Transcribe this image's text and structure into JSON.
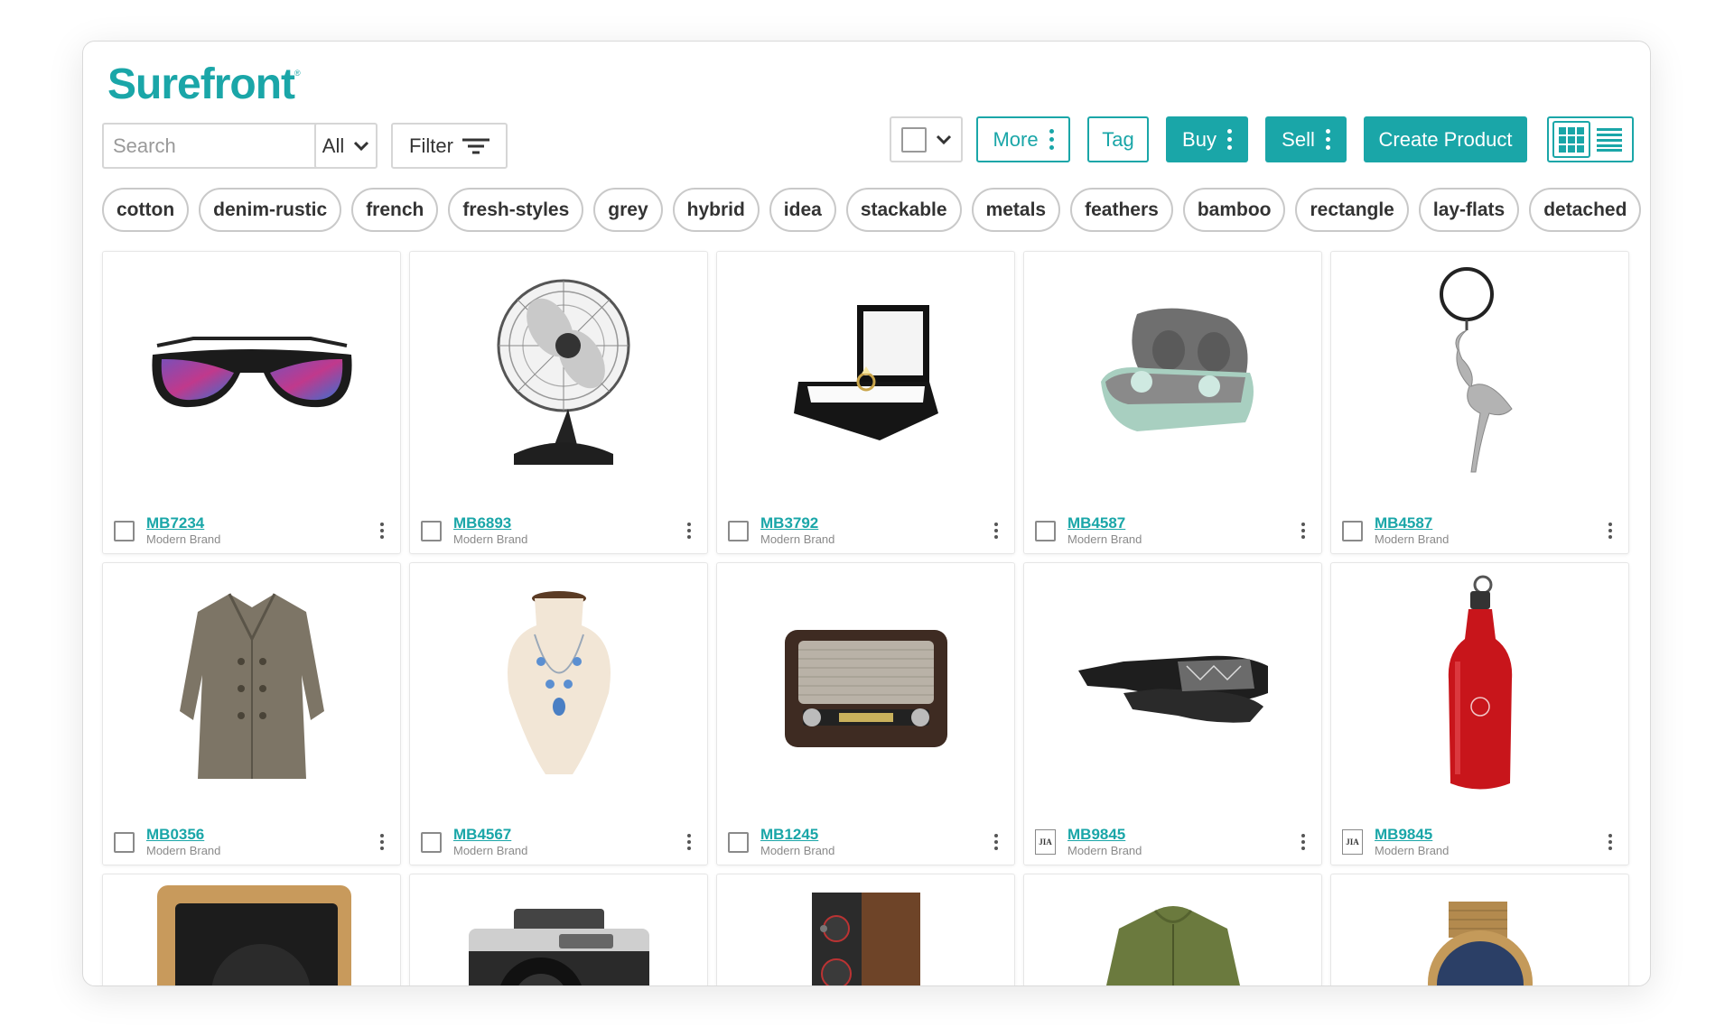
{
  "app": {
    "logo": "Surefront"
  },
  "toolbar": {
    "search_placeholder": "Search",
    "scope_label": "All",
    "filter_label": "Filter",
    "more_label": "More",
    "tag_label": "Tag",
    "buy_label": "Buy",
    "sell_label": "Sell",
    "create_label": "Create Product"
  },
  "tags": [
    "cotton",
    "denim-rustic",
    "french",
    "fresh-styles",
    "grey",
    "hybrid",
    "idea",
    "stackable",
    "metals",
    "feathers",
    "bamboo",
    "rectangle",
    "lay-flats",
    "detached"
  ],
  "products": [
    {
      "code": "MB7234",
      "brand": "Modern Brand",
      "image": "sunglasses-icon",
      "select": "checkbox"
    },
    {
      "code": "MB6893",
      "brand": "Modern Brand",
      "image": "desk-fan-icon",
      "select": "checkbox"
    },
    {
      "code": "MB3792",
      "brand": "Modern Brand",
      "image": "ring-box-icon",
      "select": "checkbox"
    },
    {
      "code": "MB4587",
      "brand": "Modern Brand",
      "image": "earbuds-case-icon",
      "select": "checkbox"
    },
    {
      "code": "MB4587",
      "brand": "Modern Brand",
      "image": "flamingo-keychain-icon",
      "select": "checkbox"
    },
    {
      "code": "MB0356",
      "brand": "Modern Brand",
      "image": "trench-coat-icon",
      "select": "checkbox"
    },
    {
      "code": "MB4567",
      "brand": "Modern Brand",
      "image": "necklace-bust-icon",
      "select": "checkbox"
    },
    {
      "code": "MB1245",
      "brand": "Modern Brand",
      "image": "retro-radio-icon",
      "select": "checkbox"
    },
    {
      "code": "MB9845",
      "brand": "Modern Brand",
      "image": "gloves-icon",
      "select": "brand-logo",
      "brand_logo": "JIA"
    },
    {
      "code": "MB9845",
      "brand": "Modern Brand",
      "image": "water-bottle-icon",
      "select": "brand-logo",
      "brand_logo": "JIA"
    }
  ],
  "partial_products": [
    {
      "image": "wood-speaker-icon"
    },
    {
      "image": "camera-icon"
    },
    {
      "image": "tower-speaker-icon"
    },
    {
      "image": "green-jacket-icon"
    },
    {
      "image": "gold-watch-icon"
    }
  ],
  "colors": {
    "accent": "#1aa6a8",
    "border": "#d6d6d6",
    "text": "#333333"
  }
}
